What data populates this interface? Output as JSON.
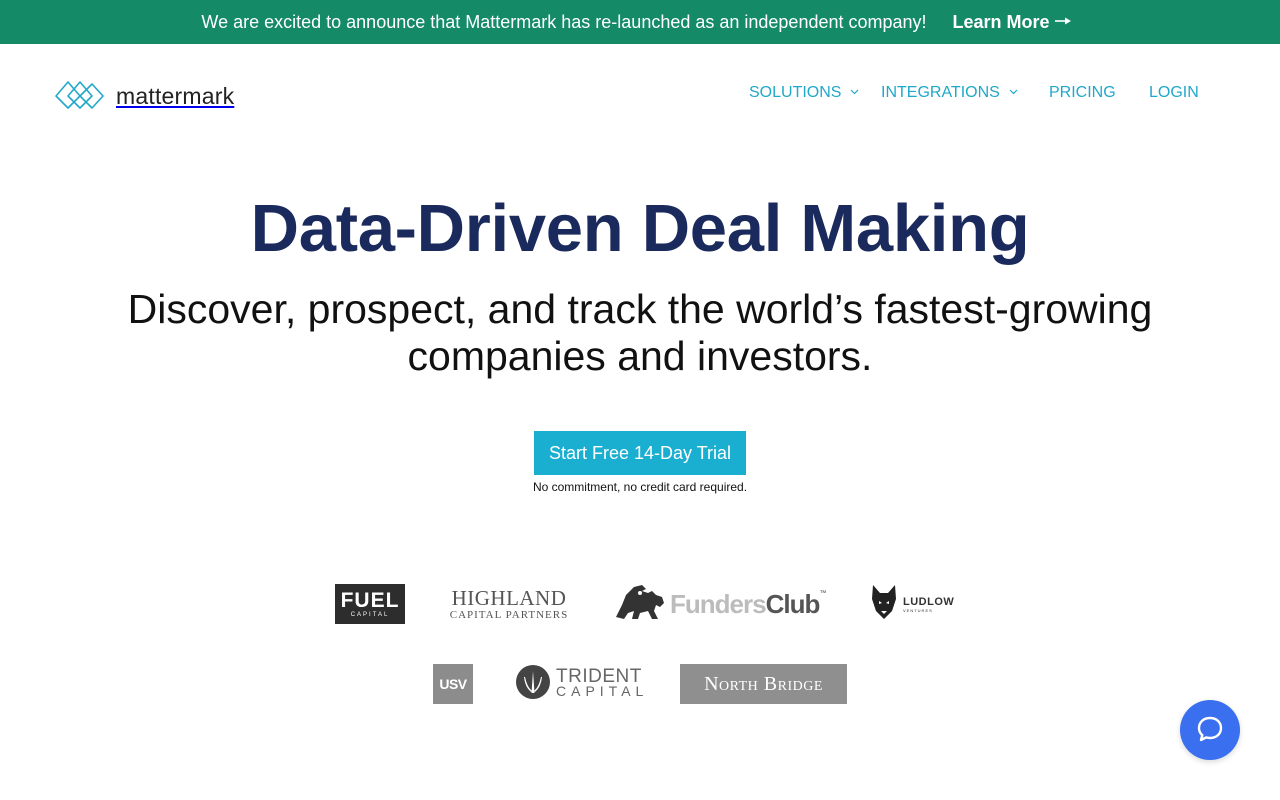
{
  "banner": {
    "message": "We are excited to announce that Mattermark has re-launched as an independent company!",
    "link_label": "Learn More",
    "bg_color": "#148a66"
  },
  "logo": {
    "wordmark": "mattermark",
    "icon": "mattermark-logo-icon"
  },
  "nav": {
    "items": [
      {
        "label": "SOLUTIONS",
        "has_dropdown": true
      },
      {
        "label": "INTEGRATIONS",
        "has_dropdown": true
      },
      {
        "label": "PRICING",
        "has_dropdown": false
      },
      {
        "label": "LOGIN",
        "has_dropdown": false
      }
    ],
    "color": "#1fa8c9"
  },
  "hero": {
    "title": "Data-Driven Deal Making",
    "subtitle_line1": "Discover, prospect, and track the world’s fastest-growing",
    "subtitle_line2": "companies and investors.",
    "cta_label": "Start Free 14-Day Trial",
    "cta_note": "No commitment, no credit card required.",
    "title_color": "#1b2a5c",
    "cta_color": "#1aaed0"
  },
  "customer_logos": {
    "fuel": {
      "big": "FUEL",
      "small": "CAPITAL"
    },
    "highland": {
      "big": "HIGHLAND",
      "small": "CAPITAL PARTNERS"
    },
    "funders": {
      "part1": "Funders",
      "part2": "Club",
      "tm": "™"
    },
    "ludlow": {
      "big": "LUDLOW",
      "small": "VENTURES"
    },
    "usv": {
      "text": "USV"
    },
    "trident": {
      "big": "TRIDENT",
      "small": "CAPITAL"
    },
    "northbridge": {
      "text": "North Bridge"
    }
  },
  "help_widget": {
    "icon": "chat-bubble-icon",
    "color": "#3a6ff0"
  }
}
